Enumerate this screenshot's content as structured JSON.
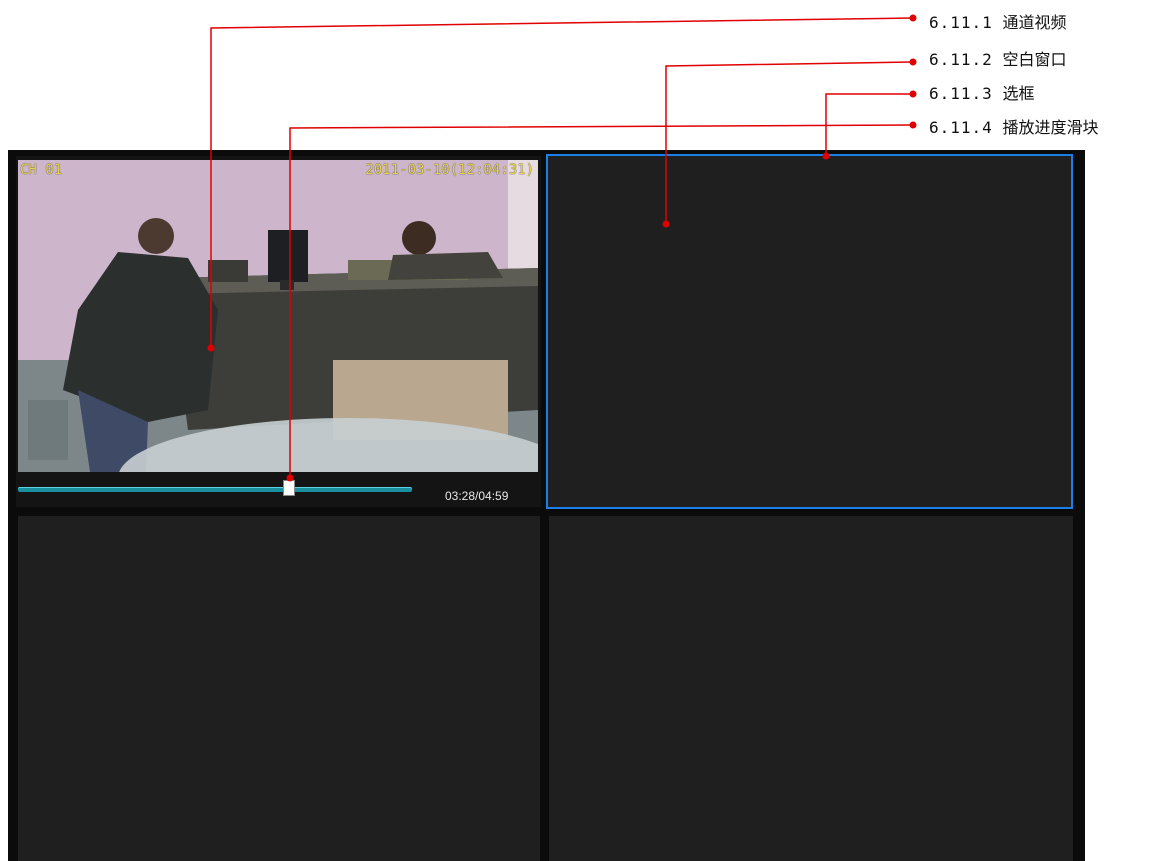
{
  "callouts": [
    {
      "number": "6.11.1",
      "label": "通道视频"
    },
    {
      "number": "6.11.2",
      "label": "空白窗口"
    },
    {
      "number": "6.11.3",
      "label": "选框"
    },
    {
      "number": "6.11.4",
      "label": "播放进度滑块"
    }
  ],
  "panes": {
    "channel_video": {
      "osd_channel": "CH 01",
      "osd_datetime": "2011-03-10(12:04:31)"
    }
  },
  "playback": {
    "progress_fraction": 0.689,
    "time_readout": "03:28/04:59"
  },
  "colors": {
    "selection_border": "#1a7fe8",
    "leader_lines": "#e00000",
    "progress_track": "#1a8fa0",
    "pane_background": "#1f1f1f"
  }
}
